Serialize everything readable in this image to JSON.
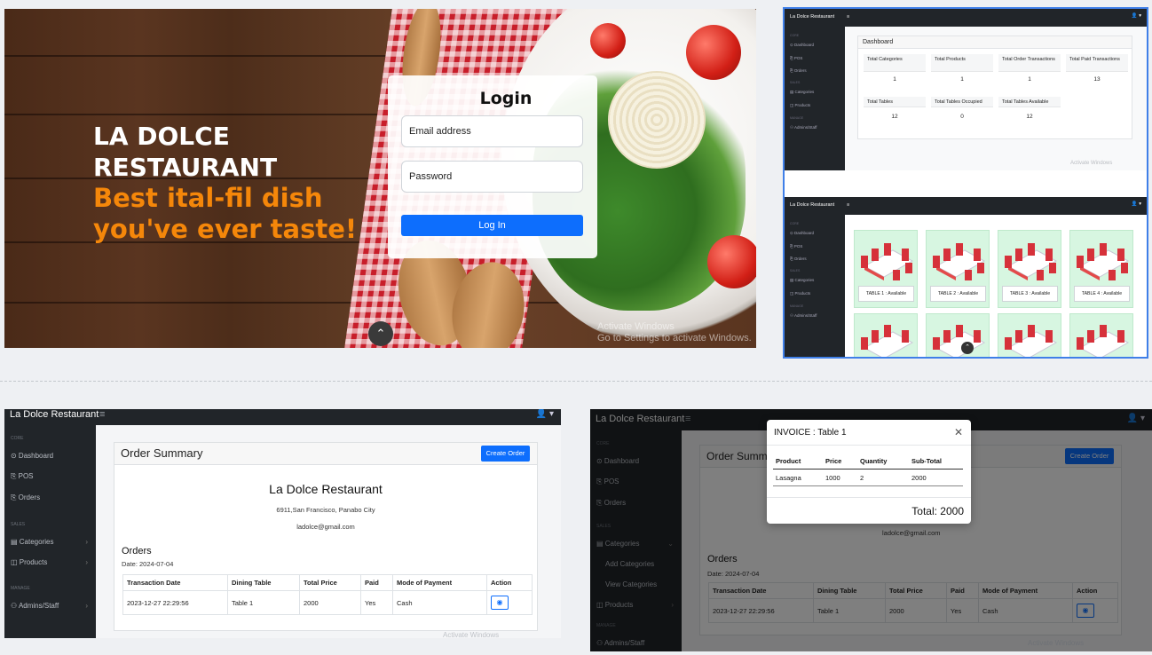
{
  "login_page": {
    "brand_line1": "LA DOLCE",
    "brand_line2": "RESTAURANT",
    "tagline_line1": "Best ital-fil dish",
    "tagline_line2": "you've ever taste!",
    "form_title": "Login",
    "email_placeholder": "Email address",
    "password_placeholder": "Password",
    "login_button": "Log In",
    "activate_line1": "Activate Windows",
    "activate_line2": "Go to Settings to activate Windows."
  },
  "app": {
    "name": "La Dolce Restaurant",
    "hamburger": "≡",
    "user_icon": "👤 ▾",
    "sidebar": {
      "core_heading": "CORE",
      "dashboard": "⊙ Dashboard",
      "pos": "⎘ POS",
      "orders": "⎘ Orders",
      "sales_heading": "SALES",
      "categories": "▤ Categories",
      "products": "◫ Products",
      "manage_heading": "MANAGE",
      "admins": "⚇ Admins/Staff",
      "add_categories": "Add Categories",
      "view_categories": "View Categories"
    }
  },
  "dashboard": {
    "title": "Dashboard",
    "stats": [
      {
        "label": "Total Categories",
        "value": "1"
      },
      {
        "label": "Total Products",
        "value": "1"
      },
      {
        "label": "Total Order Transactions",
        "value": "1"
      },
      {
        "label": "Total Paid Transactions",
        "value": "13"
      },
      {
        "label": "Total Tables",
        "value": "12"
      },
      {
        "label": "Total Tables Occupied",
        "value": "0"
      },
      {
        "label": "Total Tables Available",
        "value": "12"
      }
    ],
    "activate": "Activate Windows"
  },
  "pos": {
    "tables": [
      "TABLE 1 : Available",
      "TABLE 2 : Available",
      "TABLE 3 : Available",
      "TABLE 4 : Available"
    ]
  },
  "order_summary": {
    "title": "Order Summary",
    "create_button": "Create Order",
    "restaurant_name": "La Dolce Restaurant",
    "address": "6911,San Francisco, Panabo City",
    "email": "ladolce@gmail.com",
    "orders_heading": "Orders",
    "date": "Date: 2024-07-04",
    "columns": [
      "Transaction Date",
      "Dining Table",
      "Total Price",
      "Paid",
      "Mode of Payment",
      "Action"
    ],
    "rows": [
      {
        "date": "2023-12-27 22:29:56",
        "table": "Table 1",
        "price": "2000",
        "paid": "Yes",
        "mode": "Cash"
      }
    ],
    "view_icon": "◉",
    "activate": "Activate Windows"
  },
  "invoice": {
    "page_title_partial": "Order Summ",
    "modal_title": "INVOICE : Table 1",
    "close": "✕",
    "columns": [
      "Product",
      "Price",
      "Quantity",
      "Sub-Total"
    ],
    "rows": [
      {
        "product": "Lasagna",
        "price": "1000",
        "qty": "2",
        "subtotal": "2000"
      }
    ],
    "total": "Total: 2000",
    "activate": "Activate Windows"
  }
}
